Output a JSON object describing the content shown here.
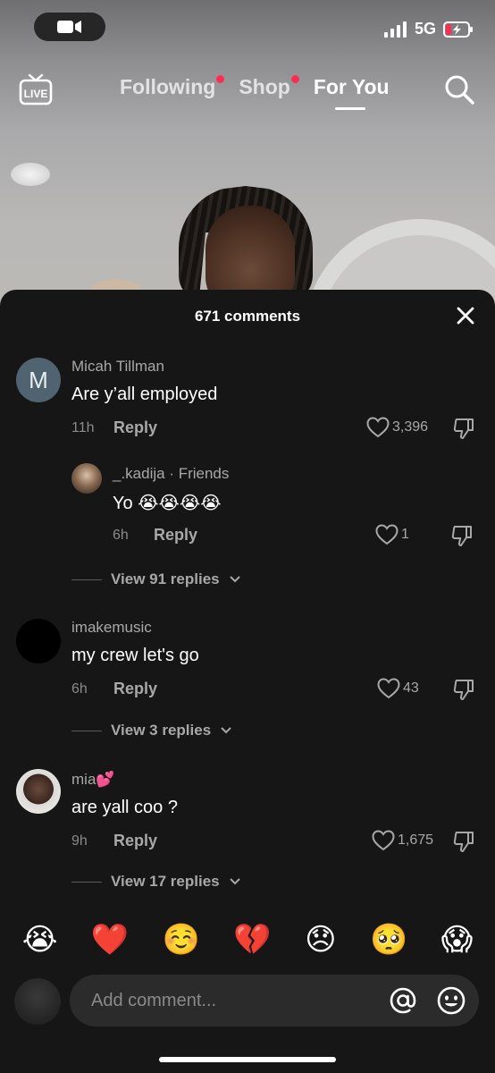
{
  "status_bar": {
    "network": "5G"
  },
  "top_nav": {
    "live_label": "LIVE",
    "tabs": [
      {
        "label": "Following",
        "dot": true
      },
      {
        "label": "Shop",
        "dot": true
      },
      {
        "label": "For You",
        "active": true
      }
    ]
  },
  "comments_sheet": {
    "title": "671 comments",
    "comments": [
      {
        "avatar_letter": "M",
        "username": "Micah Tillman",
        "text": "Are y’all employed",
        "time": "11h",
        "reply_label": "Reply",
        "likes": "3,396"
      },
      {
        "username": "_.kadija · Friends",
        "text": "Yo 😭😭😭😭",
        "time": "6h",
        "reply_label": "Reply",
        "likes": "1",
        "is_reply": true
      },
      {
        "username": "imakemusic",
        "text": "my crew let's go",
        "time": "6h",
        "reply_label": "Reply",
        "likes": "43"
      },
      {
        "username": "mia💕",
        "text": "are yall coo ?",
        "time": "9h",
        "reply_label": "Reply",
        "likes": "1,675"
      }
    ],
    "view_replies": [
      "View 91 replies",
      "View 3 replies",
      "View 17 replies"
    ]
  },
  "emoji_bar": [
    "😭",
    "❤️",
    "☺️",
    "💔",
    "😞",
    "🥺",
    "😱"
  ],
  "input": {
    "placeholder": "Add comment..."
  },
  "colors": {
    "accent": "#fe2c55",
    "sheet_bg": "#161616",
    "input_bg": "#2b2b2b",
    "muted_text": "#a8a8a8"
  }
}
